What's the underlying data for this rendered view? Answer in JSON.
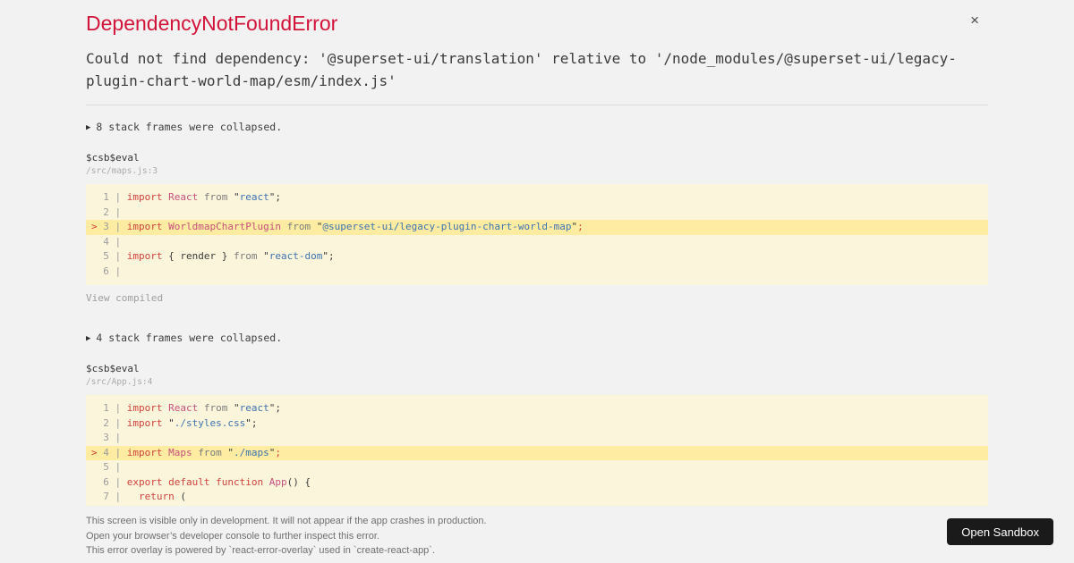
{
  "colors": {
    "page-bg": "#f2f2f2",
    "accent": "#d2143a",
    "code-bg": "#fbf5dc",
    "code-hl": "#fdeca1",
    "kw": "#d1423b",
    "id": "#c9517d",
    "str": "#3f73b0",
    "pl": "#3c3c3c",
    "gr": "#7c7c7c",
    "lineno": "#9c9c9c",
    "muted": "#ababab",
    "btn-bg": "#1a1a1a"
  },
  "header": {
    "title": "DependencyNotFoundError",
    "close_label": "×"
  },
  "message": "Could not find dependency: '@superset-ui/translation' relative to '/node_modules/@superset-ui/legacy-plugin-chart-world-map/esm/index.js'",
  "collapse_marker": "▶",
  "sections": [
    {
      "collapsed_note": "8 stack frames were collapsed.",
      "frame_fn": "$csb$eval",
      "frame_loc": "/src/maps.js:3",
      "view_compiled": "View compiled",
      "code": {
        "lines": [
          {
            "no": "1",
            "marked": false,
            "tokens": [
              [
                "import",
                "kw"
              ],
              [
                " ",
                "pl"
              ],
              [
                "React",
                "id"
              ],
              [
                " ",
                "pl"
              ],
              [
                "from",
                "gr"
              ],
              [
                " ",
                "pl"
              ],
              [
                "\"",
                "pl"
              ],
              [
                "react",
                "str"
              ],
              [
                "\"",
                "pl"
              ],
              [
                ";",
                "pl"
              ]
            ]
          },
          {
            "no": "2",
            "marked": false,
            "tokens": []
          },
          {
            "no": "3",
            "marked": true,
            "tokens": [
              [
                "import",
                "kw"
              ],
              [
                " ",
                "pl"
              ],
              [
                "WorldmapChartPlugin",
                "id"
              ],
              [
                " ",
                "pl"
              ],
              [
                "from",
                "gr"
              ],
              [
                " ",
                "pl"
              ],
              [
                "\"",
                "pl"
              ],
              [
                "@superset-ui/legacy-plugin-chart-world-map",
                "str"
              ],
              [
                "\"",
                "pl"
              ],
              [
                ";",
                "kw"
              ]
            ]
          },
          {
            "no": "4",
            "marked": false,
            "tokens": []
          },
          {
            "no": "5",
            "marked": false,
            "tokens": [
              [
                "import",
                "kw"
              ],
              [
                " { render } ",
                "pl"
              ],
              [
                "from",
                "gr"
              ],
              [
                " ",
                "pl"
              ],
              [
                "\"",
                "pl"
              ],
              [
                "react-dom",
                "str"
              ],
              [
                "\"",
                "pl"
              ],
              [
                ";",
                "pl"
              ]
            ]
          },
          {
            "no": "6",
            "marked": false,
            "tokens": []
          }
        ]
      }
    },
    {
      "collapsed_note": "4 stack frames were collapsed.",
      "frame_fn": "$csb$eval",
      "frame_loc": "/src/App.js:4",
      "view_compiled": "View compiled",
      "code": {
        "lines": [
          {
            "no": "1",
            "marked": false,
            "tokens": [
              [
                "import",
                "kw"
              ],
              [
                " ",
                "pl"
              ],
              [
                "React",
                "id"
              ],
              [
                " ",
                "pl"
              ],
              [
                "from",
                "gr"
              ],
              [
                " ",
                "pl"
              ],
              [
                "\"",
                "pl"
              ],
              [
                "react",
                "str"
              ],
              [
                "\"",
                "pl"
              ],
              [
                ";",
                "pl"
              ]
            ]
          },
          {
            "no": "2",
            "marked": false,
            "tokens": [
              [
                "import",
                "kw"
              ],
              [
                " ",
                "pl"
              ],
              [
                "\"",
                "pl"
              ],
              [
                "./styles.css",
                "str"
              ],
              [
                "\"",
                "pl"
              ],
              [
                ";",
                "pl"
              ]
            ]
          },
          {
            "no": "3",
            "marked": false,
            "tokens": []
          },
          {
            "no": "4",
            "marked": true,
            "tokens": [
              [
                "import",
                "kw"
              ],
              [
                " ",
                "pl"
              ],
              [
                "Maps",
                "id"
              ],
              [
                " ",
                "pl"
              ],
              [
                "from",
                "gr"
              ],
              [
                " ",
                "pl"
              ],
              [
                "\"",
                "pl"
              ],
              [
                "./maps",
                "str"
              ],
              [
                "\"",
                "pl"
              ],
              [
                ";",
                "kw"
              ]
            ]
          },
          {
            "no": "5",
            "marked": false,
            "tokens": []
          },
          {
            "no": "6",
            "marked": false,
            "tokens": [
              [
                "export",
                "kw"
              ],
              [
                " ",
                "pl"
              ],
              [
                "default",
                "kw"
              ],
              [
                " ",
                "pl"
              ],
              [
                "function",
                "kw"
              ],
              [
                " ",
                "pl"
              ],
              [
                "App",
                "id"
              ],
              [
                "()",
                "pl"
              ],
              [
                " {",
                "pl"
              ]
            ]
          },
          {
            "no": "7",
            "marked": false,
            "tokens": [
              [
                "  ",
                "pl"
              ],
              [
                "return",
                "kw"
              ],
              [
                " (",
                "pl"
              ]
            ]
          }
        ]
      }
    }
  ],
  "footer": {
    "lines": [
      "This screen is visible only in development. It will not appear if the app crashes in production.",
      "Open your browser’s developer console to further inspect this error.",
      "This error overlay is powered by `react-error-overlay` used in `create-react-app`."
    ],
    "open_sandbox_label": "Open Sandbox"
  }
}
